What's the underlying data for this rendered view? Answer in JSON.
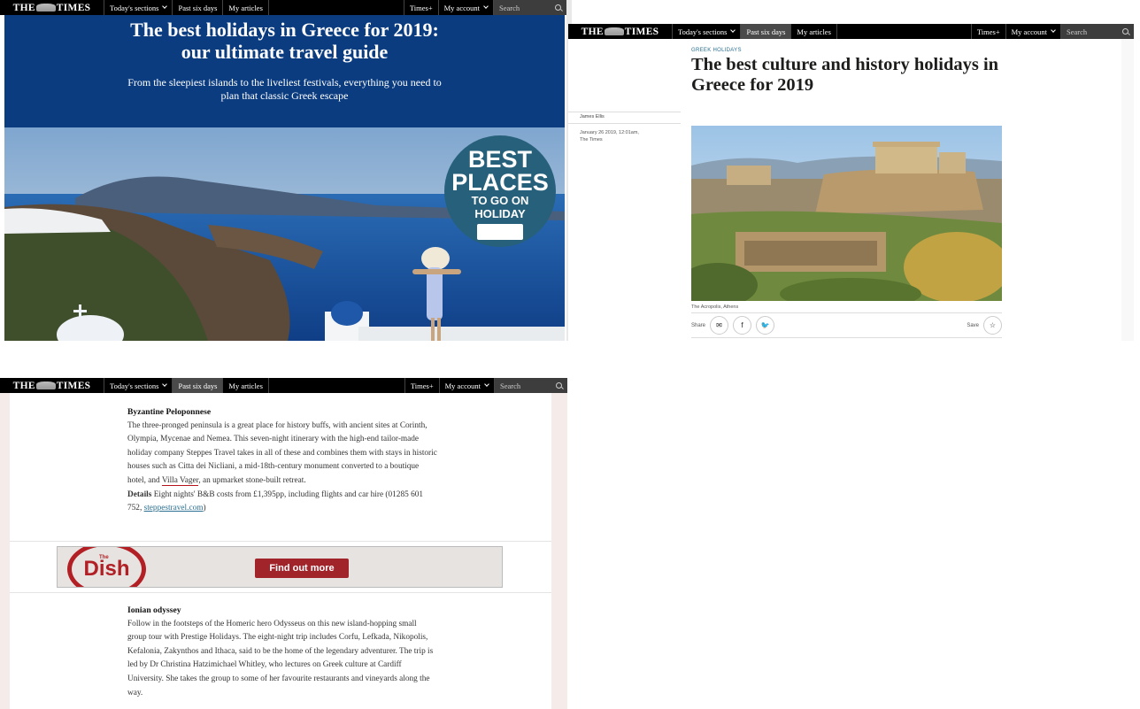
{
  "nav": {
    "logo": [
      "THE",
      "TIMES"
    ],
    "todays_sections": "Today's sections",
    "past_six_days": "Past six days",
    "my_articles": "My articles",
    "times_plus": "Times+",
    "my_account": "My account",
    "search_placeholder": "Search"
  },
  "hero": {
    "title_line1": "The best holidays in Greece for 2019:",
    "title_line2": "our ultimate travel guide",
    "subtitle": "From the sleepiest islands to the liveliest festivals, everything you need to plan that classic Greek escape",
    "badge": [
      "BEST",
      "PLACES",
      "TO GO ON",
      "HOLIDAY"
    ]
  },
  "article": {
    "kicker": "GREEK HOLIDAYS",
    "title": "The best culture and history holidays in Greece for 2019",
    "author": "James Ellis",
    "date": "January 26 2019, 12:01am,",
    "publication": "The Times",
    "caption": "The Acropolis, Athens",
    "share_label": "Share",
    "save_label": "Save"
  },
  "body": {
    "section1": {
      "heading": "Byzantine Peloponnese",
      "text_before_link": "The three-pronged peninsula is a great place for history buffs, with ancient sites at Corinth, Olympia, Mycenae and Nemea. This seven-night itinerary with the high-end tailor-made holiday company Steppes Travel takes in all of these and combines them with stays in historic houses such as Citta dei Nicliani, a mid-18th-century monument converted to a boutique hotel, and ",
      "link_text": "Villa Vager",
      "text_after_link": ", an upmarket stone-built retreat.",
      "details_label": "Details",
      "details_text": " Eight nights' B&B costs from £1,395pp, including flights and car hire (01285 601 752, ",
      "details_link": "steppestravel.com",
      "details_end": ")"
    },
    "ad": {
      "brand_small": "The",
      "brand": "Dish",
      "cta": "Find out more"
    },
    "section2": {
      "heading": "Ionian odyssey",
      "text": "Follow in the footsteps of the Homeric hero Odysseus on this new island-hopping small group tour with Prestige Holidays. The eight-night trip includes Corfu, Lefkada, Nikopolis, Kefalonia, Zakynthos and Ithaca, said to be the home of the legendary adventurer. The trip is led by Dr Christina Hatzimichael Whitley, who lectures on Greek culture at Cardiff University. She takes the group to some of her favourite restaurants and vineyards along the way."
    }
  }
}
